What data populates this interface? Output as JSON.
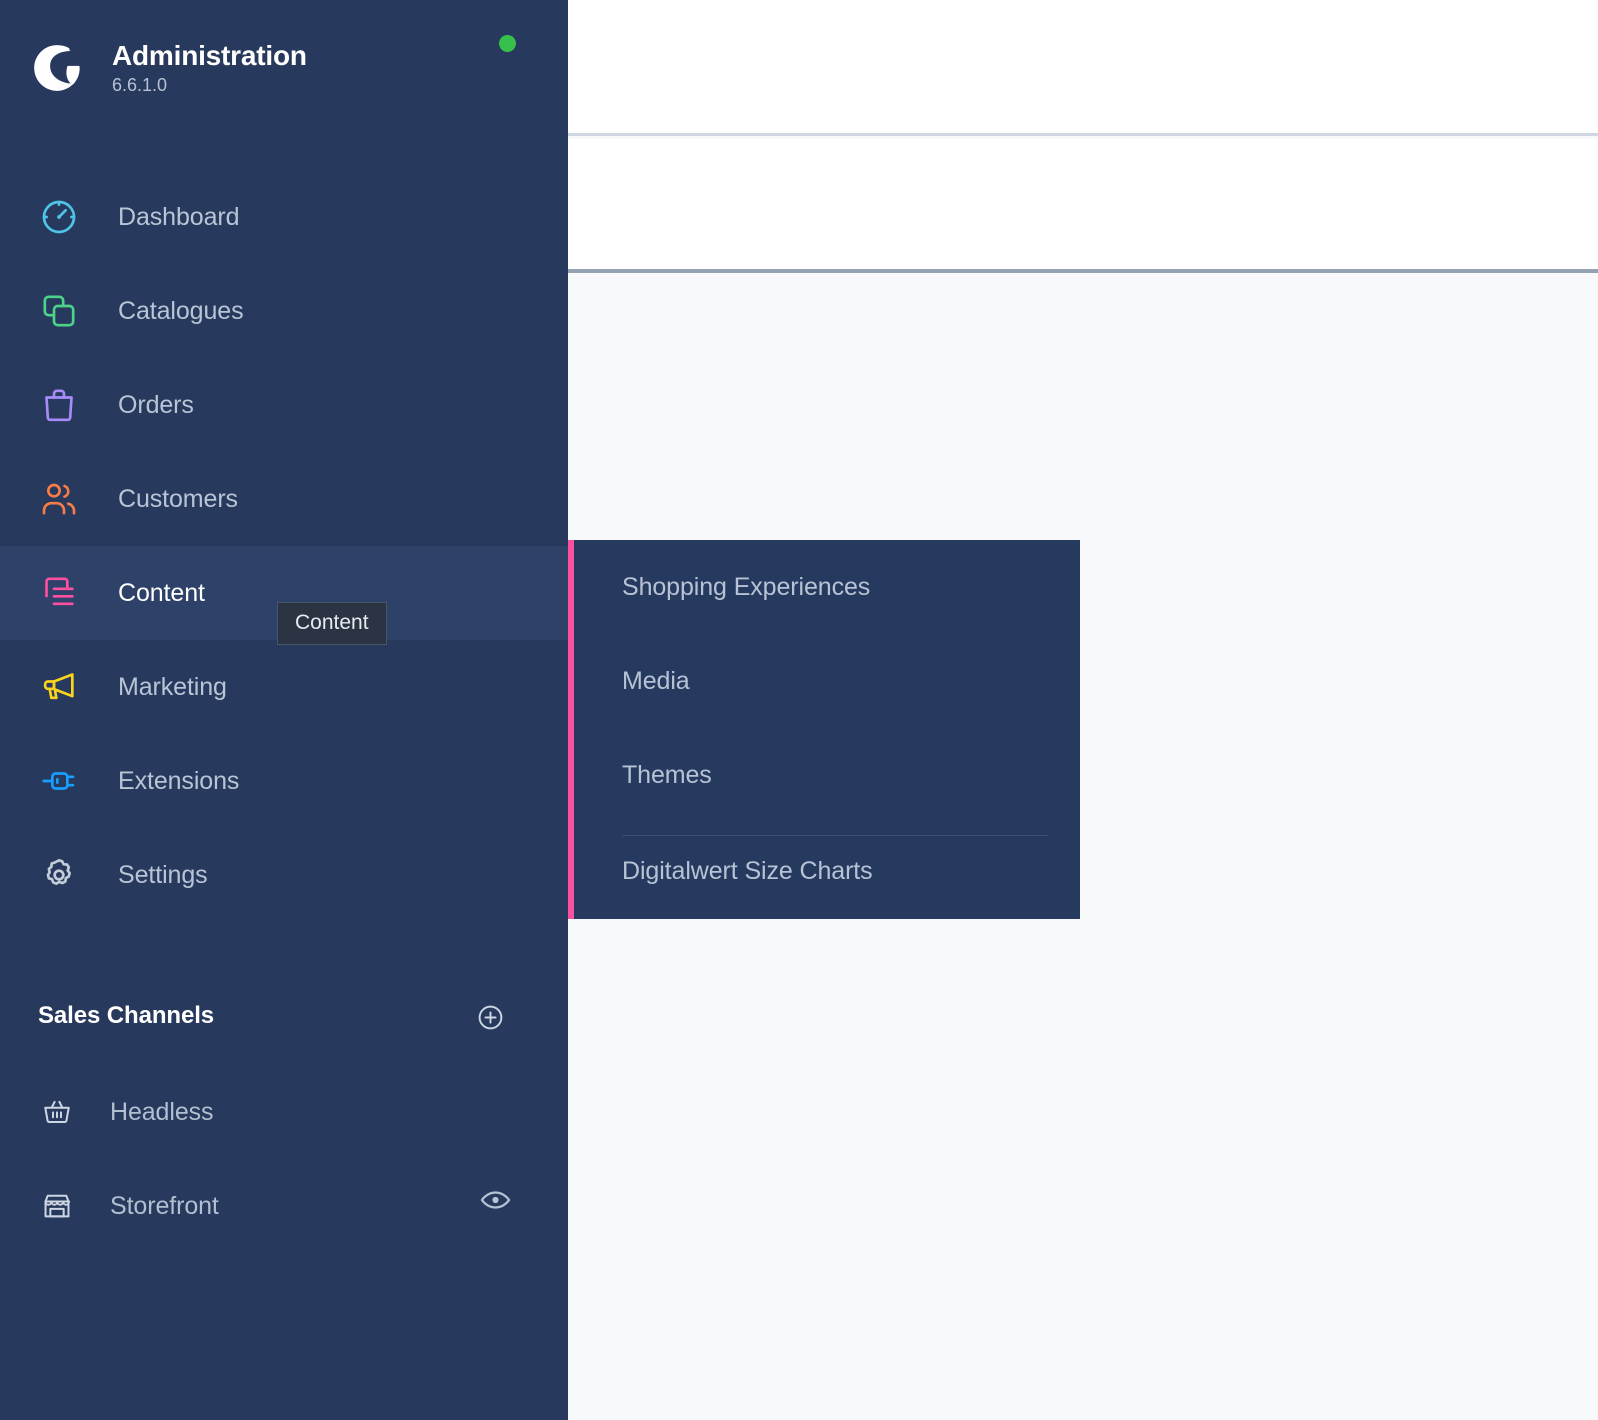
{
  "brand": {
    "logo_icon": "shopware-logo",
    "title": "Administration",
    "version": "6.6.1.0",
    "status_dot_icon": "status-online-dot",
    "status_color": "#37c14a"
  },
  "sidebar": {
    "background_color": "#27395c",
    "active_background_color": "#2e4169",
    "items": [
      {
        "label": "Dashboard",
        "icon": "dashboard-gauge-icon",
        "color": "#4fc3e8",
        "active": false
      },
      {
        "label": "Catalogues",
        "icon": "catalogues-stacked-squares-icon",
        "color": "#4bd38a",
        "active": false
      },
      {
        "label": "Orders",
        "icon": "orders-bag-icon",
        "color": "#a78bfa",
        "active": false
      },
      {
        "label": "Customers",
        "icon": "customers-people-icon",
        "color": "#f97b45",
        "active": false
      },
      {
        "label": "Content",
        "icon": "content-document-list-icon",
        "color": "#fc50a0",
        "active": true
      },
      {
        "label": "Marketing",
        "icon": "marketing-megaphone-icon",
        "color": "#fad31d",
        "active": false
      },
      {
        "label": "Extensions",
        "icon": "extensions-plug-icon",
        "color": "#189eff",
        "active": false
      },
      {
        "label": "Settings",
        "icon": "settings-gear-icon",
        "color": "#c3ccd9",
        "active": false
      }
    ]
  },
  "tooltip": {
    "label": "Content"
  },
  "sales_channels": {
    "title": "Sales Channels",
    "add_icon": "plus-circle-icon",
    "items": [
      {
        "label": "Headless",
        "icon": "basket-icon",
        "trailing_icon": ""
      },
      {
        "label": "Storefront",
        "icon": "storefront-shop-icon",
        "trailing_icon": "eye-icon"
      }
    ]
  },
  "flyout": {
    "accent_color": "#fc50a0",
    "background_color": "#253a5e",
    "items": [
      {
        "label": "Shopping Experiences",
        "divider_before": false
      },
      {
        "label": "Media",
        "divider_before": false
      },
      {
        "label": "Themes",
        "divider_before": false
      },
      {
        "label": "Digitalwert Size Charts",
        "divider_before": true
      }
    ]
  },
  "content": {
    "background_color": "#f8f9fb",
    "topbar_background_color": "#ffffff",
    "topbar_border_color": "#cfd7e2",
    "divider_color": "#94a3b4"
  }
}
